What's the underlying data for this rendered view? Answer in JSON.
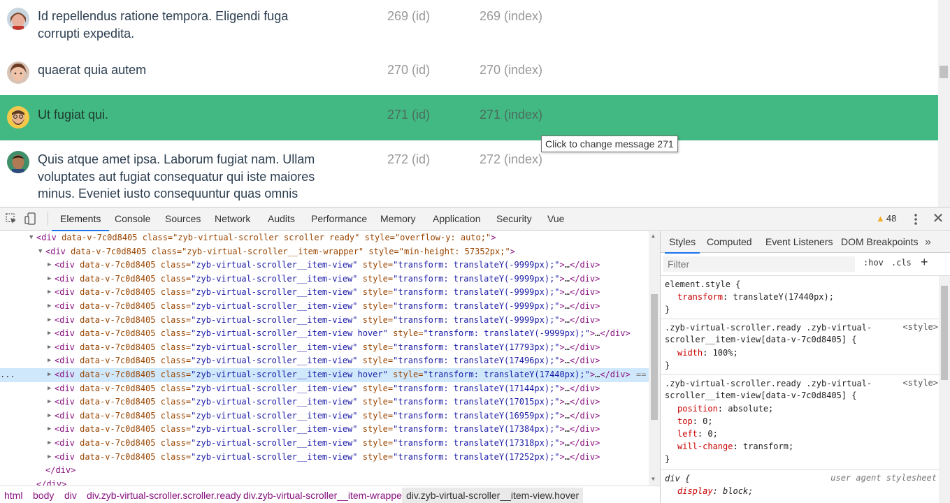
{
  "messages": [
    {
      "text": "Id repellendus ratione tempora. Eligendi fuga corrupti expedita.",
      "id": "269 (id)",
      "index": "269 (index)",
      "avatar": "avatar-woman-icon"
    },
    {
      "text": "quaerat quia autem",
      "id": "270 (id)",
      "index": "270 (index)",
      "avatar": "avatar-woman-icon"
    },
    {
      "text": "Ut fugiat qui.",
      "id": "271 (id)",
      "index": "271 (index)",
      "avatar": "avatar-bearded-man-icon"
    },
    {
      "text": "Quis atque amet ipsa. Laborum fugiat nam. Ullam voluptates aut fugiat consequatur qui iste maiores minus. Eveniet iusto consequuntur quas omnis",
      "id": "272 (id)",
      "index": "272 (index)",
      "avatar": "avatar-man-icon"
    }
  ],
  "tooltip": "Click to change message 271",
  "colors": {
    "highlight": "#42b983",
    "selection": "#cfe8fc",
    "tab_active": "#1a73e8"
  },
  "devtools": {
    "tabs": [
      "Elements",
      "Console",
      "Sources",
      "Network",
      "Audits",
      "Performance",
      "Memory",
      "Application",
      "Security",
      "Vue"
    ],
    "active_tab": "Elements",
    "warnings": "48",
    "toolbar_icons": [
      "inspect-element-icon",
      "device-toggle-icon",
      "more-options-icon",
      "close-icon"
    ]
  },
  "elements_tree": {
    "root": {
      "tag": "div",
      "attrs": "data-v-7c0d8405 class=\"zyb-virtual-scroller scroller ready\" style=\"overflow-y: auto;\"",
      "open": "<div ",
      "close": ">"
    },
    "wrapper": {
      "open": "<div ",
      "attrs": "data-v-7c0d8405 class=\"zyb-virtual-scroller__item-wrapper\" style=\"min-height: 57352px;\"",
      "close": ">"
    },
    "items": [
      {
        "class": "zyb-virtual-scroller__item-view",
        "transform": "transform: translateY(-9999px);"
      },
      {
        "class": "zyb-virtual-scroller__item-view",
        "transform": "transform: translateY(-9999px);"
      },
      {
        "class": "zyb-virtual-scroller__item-view",
        "transform": "transform: translateY(-9999px);"
      },
      {
        "class": "zyb-virtual-scroller__item-view",
        "transform": "transform: translateY(-9999px);"
      },
      {
        "class": "zyb-virtual-scroller__item-view",
        "transform": "transform: translateY(-9999px);"
      },
      {
        "class": "zyb-virtual-scroller__item-view hover",
        "transform": "transform: translateY(-9999px);"
      },
      {
        "class": "zyb-virtual-scroller__item-view",
        "transform": "transform: translateY(17793px);"
      },
      {
        "class": "zyb-virtual-scroller__item-view",
        "transform": "transform: translateY(17496px);"
      },
      {
        "class": "zyb-virtual-scroller__item-view hover",
        "transform": "transform: translateY(17440px);",
        "selected": true
      },
      {
        "class": "zyb-virtual-scroller__item-view",
        "transform": "transform: translateY(17144px);"
      },
      {
        "class": "zyb-virtual-scroller__item-view",
        "transform": "transform: translateY(17015px);"
      },
      {
        "class": "zyb-virtual-scroller__item-view",
        "transform": "transform: translateY(16959px);"
      },
      {
        "class": "zyb-virtual-scroller__item-view",
        "transform": "transform: translateY(17384px);"
      },
      {
        "class": "zyb-virtual-scroller__item-view",
        "transform": "transform: translateY(17318px);"
      },
      {
        "class": "zyb-virtual-scroller__item-view",
        "transform": "transform: translateY(17252px);"
      }
    ],
    "item_prefix": "data-v-7c0d8405",
    "ellipsis": "…",
    "close_tag": "</div>",
    "end_tag_1": "</div>",
    "end_tag_2": "</div>",
    "selected_marker": "...",
    "selected_suffix": "=="
  },
  "breadcrumbs": [
    "html",
    "body",
    "div",
    "div.zyb-virtual-scroller.scroller.ready",
    "div.zyb-virtual-scroller__item-wrapper",
    "div.zyb-virtual-scroller__item-view.hover"
  ],
  "styles_pane": {
    "tabs": [
      "Styles",
      "Computed",
      "Event Listeners",
      "DOM Breakpoints"
    ],
    "more": "»",
    "filter_placeholder": "Filter",
    "hov": ":hov",
    "cls": ".cls",
    "plus": "+",
    "rules": [
      {
        "selector": "element.style {",
        "props": [
          {
            "name": "transform",
            "value": "translateY(17440px);"
          }
        ],
        "close": "}"
      },
      {
        "selector": ".zyb-virtual-scroller.ready .zyb-virtual-",
        "selector2": "scroller__item-view[data-v-7c0d8405] {",
        "source": "<style>",
        "props": [
          {
            "name": "width",
            "value": "100%;"
          }
        ],
        "close": "}"
      },
      {
        "selector": ".zyb-virtual-scroller.ready .zyb-virtual-",
        "selector2": "scroller__item-view[data-v-7c0d8405] {",
        "source": "<style>",
        "props": [
          {
            "name": "position",
            "value": "absolute;"
          },
          {
            "name": "top",
            "value": "0;"
          },
          {
            "name": "left",
            "value": "0;"
          },
          {
            "name": "will-change",
            "value": "transform;"
          }
        ],
        "close": "}"
      },
      {
        "selector": "div {",
        "source": "user agent stylesheet",
        "props": [
          {
            "name": "display",
            "value": "block;"
          }
        ]
      }
    ]
  }
}
